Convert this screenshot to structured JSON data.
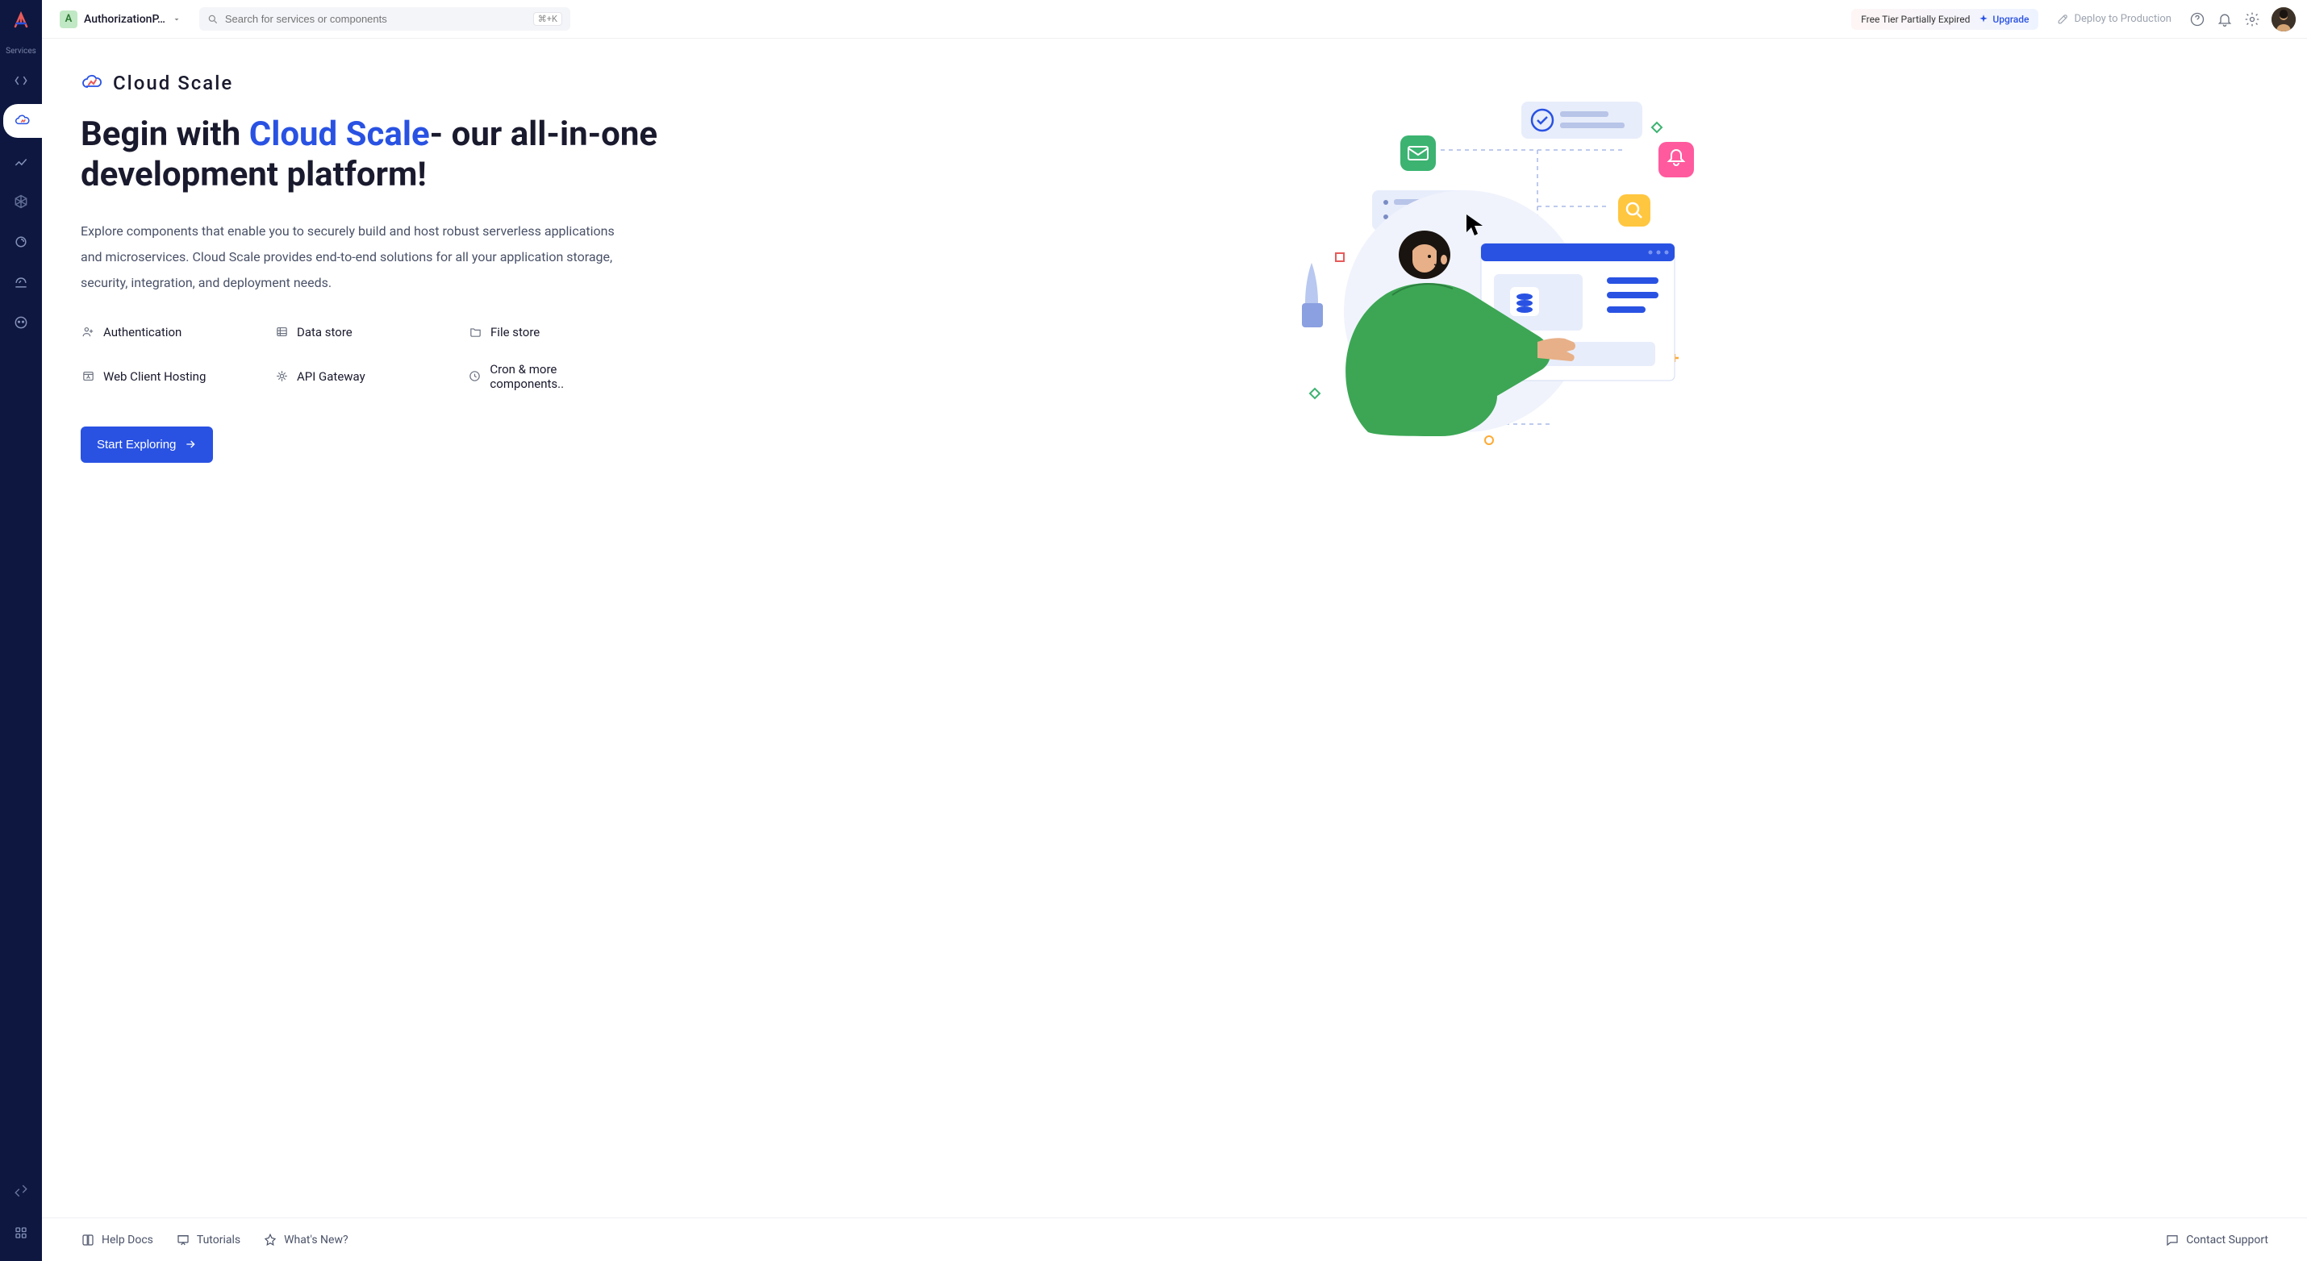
{
  "sidebar": {
    "label": "Services"
  },
  "topbar": {
    "project_badge": "A",
    "project_name": "AuthorizationP…",
    "search_placeholder": "Search for services or components",
    "search_kbd": "⌘+K",
    "upgrade_text": "Free Tier Partially Expired",
    "upgrade_btn": "Upgrade",
    "deploy_btn": "Deploy to Production"
  },
  "hero": {
    "brand": "Cloud Scale",
    "title_before": "Begin with ",
    "title_highlight": "Cloud Scale",
    "title_after": "- our all-in-one development platform!",
    "description": "Explore components that enable you to securely build and host robust serverless applications and microservices. Cloud Scale provides end-to-end solutions for all your application storage, security, integration, and deployment needs.",
    "features": [
      {
        "label": "Authentication"
      },
      {
        "label": "Data store"
      },
      {
        "label": "File store"
      },
      {
        "label": "Web Client Hosting"
      },
      {
        "label": "API Gateway"
      },
      {
        "label": "Cron & more components.."
      }
    ],
    "cta": "Start Exploring"
  },
  "footer": {
    "links": [
      {
        "label": "Help Docs"
      },
      {
        "label": "Tutorials"
      },
      {
        "label": "What's New?"
      }
    ],
    "support": "Contact Support"
  }
}
